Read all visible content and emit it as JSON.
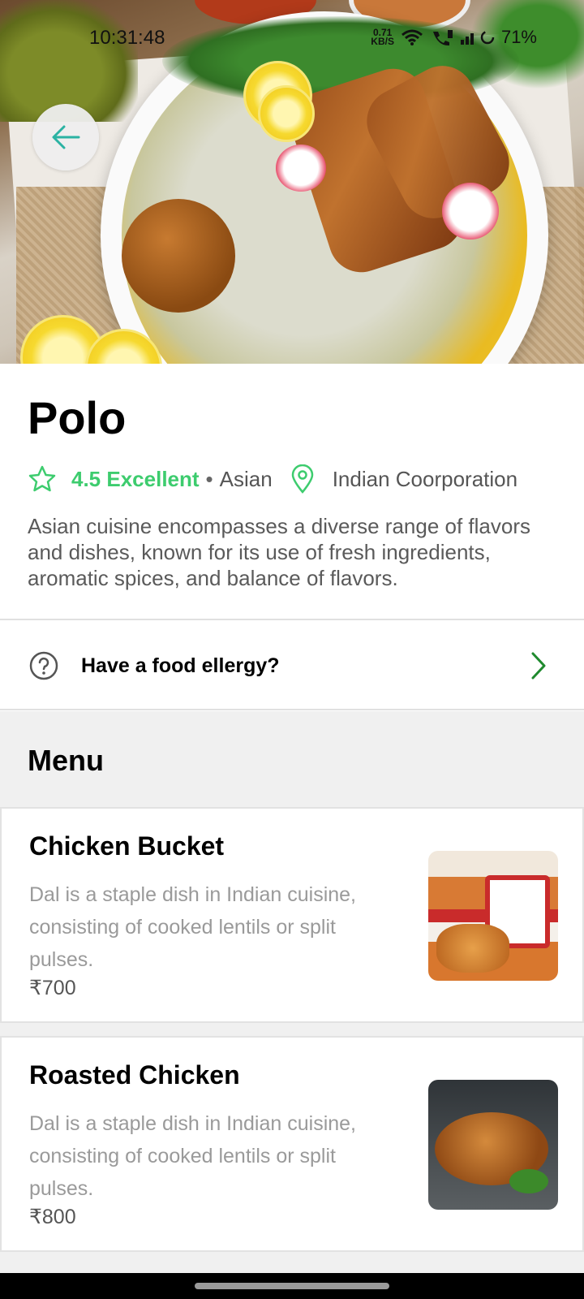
{
  "status_bar": {
    "time": "10:31:48",
    "net_speed": "0.71",
    "net_unit": "KB/S",
    "battery": "71%"
  },
  "restaurant": {
    "name": "Polo",
    "rating": "4.5 Excellent",
    "separator": "•",
    "cuisine": "Asian",
    "location": "Indian Coorporation",
    "description": "Asian cuisine encompasses a diverse range of flavors and dishes, known for its use of fresh ingredients, aromatic spices, and balance of flavors."
  },
  "allergy": {
    "label": "Have a food ellergy?"
  },
  "menu": {
    "heading": "Menu",
    "items": [
      {
        "name": "Chicken Bucket",
        "description": "Dal is a staple dish in Indian cuisine, consisting of cooked lentils or split pulses.",
        "price": "₹700"
      },
      {
        "name": "Roasted Chicken",
        "description": "Dal is a staple dish in Indian cuisine, consisting of cooked lentils or split pulses.",
        "price": "₹800"
      }
    ]
  },
  "colors": {
    "accent_green": "#3dcc6e",
    "chevron_green": "#1f8a2e",
    "back_arrow": "#2bb3a3"
  },
  "icons": {
    "back": "arrow-left-icon",
    "rating": "star-icon",
    "location": "location-pin-icon",
    "help": "question-circle-icon",
    "chevron": "chevron-right-icon"
  }
}
